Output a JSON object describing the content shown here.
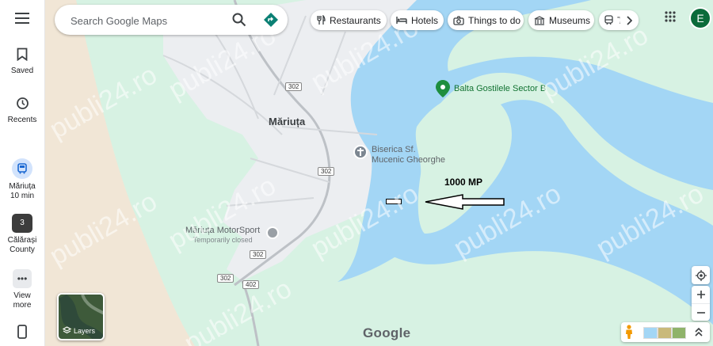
{
  "search": {
    "placeholder": "Search Google Maps"
  },
  "sidebar": {
    "saved_label": "Saved",
    "recents_label": "Recents",
    "recent_place": {
      "name": "Măriuța",
      "subtitle": "10 min"
    },
    "recent_county": {
      "name": "Călărași",
      "subtitle": "County",
      "count": "3"
    },
    "view_more_line1": "View",
    "view_more_line2": "more"
  },
  "chips": [
    {
      "label": "Restaurants",
      "icon": "restaurant-icon"
    },
    {
      "label": "Hotels",
      "icon": "hotel-icon"
    },
    {
      "label": "Things to do",
      "icon": "camera-icon"
    },
    {
      "label": "Museums",
      "icon": "museum-icon"
    },
    {
      "label": "T",
      "icon": "transit-icon"
    }
  ],
  "account": {
    "initial": "E",
    "color": "#0b6b3a"
  },
  "map": {
    "town_label": "Măriuța",
    "poi_lake": "Balta Gostilele Sector B",
    "poi_church_line1": "Biserica Sf.",
    "poi_church_line2": "Mucenic Gheorghe",
    "poi_motorsport": "Măriuța MotorSport",
    "poi_motorsport_status": "Temporarily closed",
    "road_shields": [
      "302",
      "302",
      "302",
      "302",
      "402"
    ],
    "annotation": "1000 MP",
    "watermark": "publi24.ro",
    "google_logo": "Google",
    "colors": {
      "water": "#a3d6f5",
      "land": "#d7f2e3",
      "town": "#eeeff1",
      "beach": "#f2e8d8"
    }
  },
  "layers": {
    "label": "Layers"
  }
}
